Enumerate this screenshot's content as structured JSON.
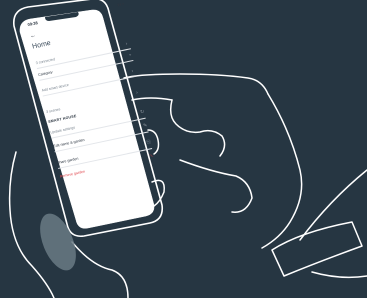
{
  "phone": {
    "status_time": "09:38",
    "status_icons": "▮▮ ■",
    "back_glyph": "←",
    "page_title": "Home",
    "rows": [
      {
        "label": "3 connected",
        "style": "muted",
        "chevron": "›"
      },
      {
        "label": "Category",
        "style": "dark",
        "chevron": "⌄"
      },
      {
        "label": "Add smart device",
        "style": "muted",
        "chevron": "›"
      },
      {
        "label": "3 scenes",
        "style": "muted",
        "chevron": "›"
      }
    ],
    "section_heading": "SMART HOUSE",
    "smart_rows": [
      {
        "label": "Update settings",
        "icon": "↻"
      },
      {
        "label": "Edit name & garden",
        "icon": "✎"
      },
      {
        "label": "Share garden",
        "icon": "⎘"
      }
    ],
    "danger_label": "Remove garden",
    "danger_icon": "␡"
  },
  "colors": {
    "background": "#263642",
    "outline": "#ffffff",
    "screen": "#ffffff",
    "thumb_highlight": "#6a7a84",
    "danger": "#e0454c"
  }
}
